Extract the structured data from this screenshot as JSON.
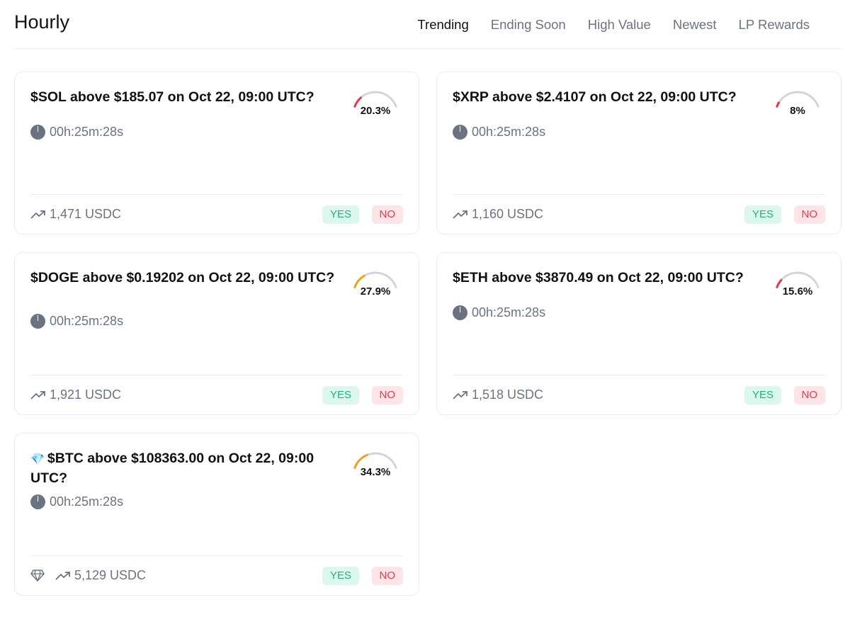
{
  "header": {
    "title": "Hourly",
    "tabs": [
      {
        "label": "Trending",
        "active": true
      },
      {
        "label": "Ending Soon",
        "active": false
      },
      {
        "label": "High Value",
        "active": false
      },
      {
        "label": "Newest",
        "active": false
      },
      {
        "label": "LP Rewards",
        "active": false
      }
    ]
  },
  "markets": [
    {
      "title": "$SOL above $185.07 on Oct 22, 09:00 UTC?",
      "timer": "00h:25m:28s",
      "probability_label": "20.3%",
      "probability": 0.203,
      "gauge_color": "#e8364d",
      "volume": "1,471 USDC",
      "yes_label": "YES",
      "no_label": "NO"
    },
    {
      "title": "$XRP above $2.4107 on Oct 22, 09:00 UTC?",
      "timer": "00h:25m:28s",
      "probability_label": "8%",
      "probability": 0.08,
      "gauge_color": "#e8364d",
      "volume": "1,160 USDC",
      "yes_label": "YES",
      "no_label": "NO"
    },
    {
      "title": "$DOGE above $0.19202 on Oct 22, 09:00 UTC?",
      "timer": "00h:25m:28s",
      "probability_label": "27.9%",
      "probability": 0.279,
      "gauge_color": "#f5a01a",
      "volume": "1,921 USDC",
      "yes_label": "YES",
      "no_label": "NO"
    },
    {
      "title": "$ETH above $3870.49 on Oct 22, 09:00 UTC?",
      "timer": "00h:25m:28s",
      "probability_label": "15.6%",
      "probability": 0.156,
      "gauge_color": "#e8364d",
      "volume": "1,518 USDC",
      "yes_label": "YES",
      "no_label": "NO"
    },
    {
      "title": "$BTC above $108363.00 on Oct 22, 09:00 UTC?",
      "title_icon": "💎",
      "timer": "00h:25m:28s",
      "probability_label": "34.3%",
      "probability": 0.343,
      "gauge_color": "#f5a01a",
      "volume": "5,129 USDC",
      "yes_label": "YES",
      "no_label": "NO"
    }
  ],
  "colors": {
    "gauge_track": "#d4d4d8",
    "muted_text": "#6b7280",
    "yes_bg": "#dcf7ec",
    "yes_text": "#22b07d",
    "no_bg": "#fde4e7",
    "no_text": "#ea3a4c"
  },
  "icons": {
    "timer": "clock-pie-icon",
    "volume": "trending-up-icon",
    "high_value": "diamond-icon"
  }
}
